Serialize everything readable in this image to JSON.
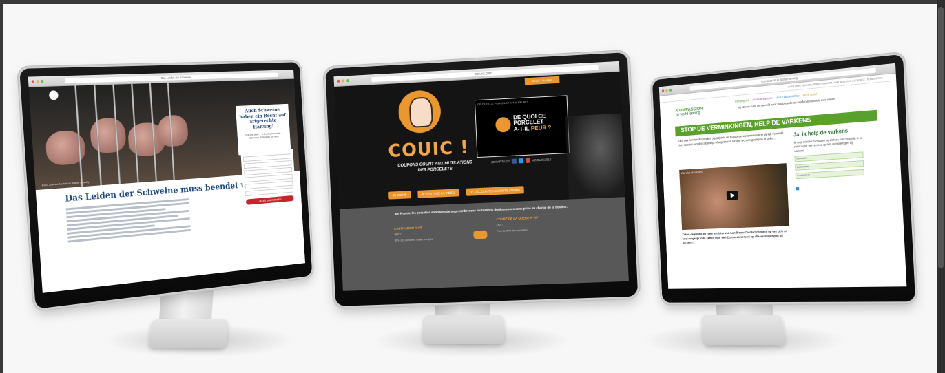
{
  "colors": {
    "background": "#f7f7f7",
    "bezel": "#0f0f0f",
    "couic_orange": "#e9972e",
    "ciwf_green": "#5aa02c",
    "de_blue": "#1f4a80",
    "de_red": "#c4262e"
  },
  "monitor_de": {
    "tab": "Das Leiden der Schweine",
    "hero_caption": "Foto: Jo-Anne McArthur / Animal Equality",
    "box_title": "Auch Schweine haben ein Recht auf artgerechte Haltung!",
    "box_text": "Fünf von zehn ... in Deutschland sind ... Schweine. Schreiben Sie uns!",
    "headline": "Das Leiden der Schweine muss beendet werden!",
    "submit": "Ja, ich unterschreibe"
  },
  "monitor_fr": {
    "tab_label": "COUIC.ORG",
    "top_tab": "Couic + la vidéo",
    "title": "COUIC !",
    "subtitle": "COUPONS COURT AUX MUTILATIONS DES PORCELETS",
    "video_caption": "DE QUOI CE PORCELET A-T-IL PEUR ?",
    "video_title_a": "DE QUOI CE",
    "video_title_b": "PORCELET",
    "video_title_c": "A-T-IL",
    "video_title_d": "PEUR ?",
    "share_label": "JE PARTAGE",
    "hashtag": "#COUIC2016",
    "buttons": [
      "JE SIGNE",
      "JE PARTAGE LA VIDÉO",
      "JE DÉCOUVRE LES MUTILATIONS"
    ],
    "intro": "En France, les porcelets subissent de trop nombreuses mutilations douloureuses sans prise en charge de la douleur.",
    "col1_title": "CASTRATION À VIF",
    "col2_title": "COUPE DE LA QUEUE À VIF",
    "col1_q": "QUI ?",
    "col1_text": "85% des porcelets mâles français",
    "col2_q": "QUI ?",
    "col2_text": "Plus de 90% des porcelets."
  },
  "monitor_nl": {
    "tab": "Compassion in World Farming",
    "top_links": "OVER ONS | NIEUWS | PERS | WAAROM | WAT WIJ DOEN | CONTACT | PUBLICATIES",
    "logo_line1": "COMPASSION",
    "logo_line2": "in world farming",
    "nav": [
      "Campagnes",
      "Acties & Mensen",
      "Voor Lidmaatschap",
      "Word actief"
    ],
    "tagline": "Wij streven naar een wereld waar landbouwdieren worden behandeld met respect",
    "banner": "STOP DE VERMINKINGEN, HELP DE VARKENS",
    "intro": "Elke dag worden duizenden biggetjes in de Europese varkensindustrie pijnlijk verminkt. Hun staarten worden afgeknipt of afgebrand, tanden worden geslepen of gekn...",
    "video_title": "Wat ziet dit varken?",
    "right_title": "Ja, ik help de varkens",
    "right_text": "Ik roep minister Schouten op zich zo snel mogelijk in te zetten voor een verbod op alle verminkingen bij varkens.",
    "fields": [
      "Voornaam*",
      "Achternaam*",
      "E-mailadres*"
    ],
    "footer_text": "Teken de petitie en roep minister van Landbouw Carola Schouten op om zich zo snel mogelijk in te zetten voor een Europees verbod op alle verminkingen bij varkens."
  }
}
